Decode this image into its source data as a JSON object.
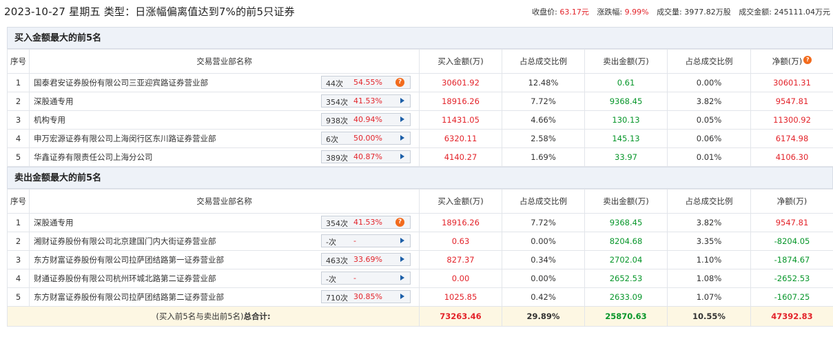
{
  "header": {
    "title": "2023-10-27 星期五 类型：日涨幅偏离值达到7%的前5只证券",
    "close_label": "收盘价:",
    "close_value": "63.17元",
    "change_label": "涨跌幅:",
    "change_value": "9.99%",
    "volume_label": "成交量:",
    "volume_value": "3977.82万股",
    "amount_label": "成交金额:",
    "amount_value": "245111.04万元"
  },
  "columns": {
    "seq": "序号",
    "name": "交易营业部名称",
    "buy": "买入金额(万)",
    "buy_ratio": "占总成交比例",
    "sell": "卖出金额(万)",
    "sell_ratio": "占总成交比例",
    "net": "净额(万)"
  },
  "buy_section": {
    "title": "买入金额最大的前5名",
    "rows": [
      {
        "seq": "1",
        "name": "国泰君安证券股份有限公司三亚迎宾路证券营业部",
        "count": "44次",
        "rate": "54.55%",
        "icon": "question-icon",
        "buy": "30601.92",
        "buy_ratio": "12.48%",
        "sell": "0.61",
        "sell_ratio": "0.00%",
        "net": "30601.31"
      },
      {
        "seq": "2",
        "name": "深股通专用",
        "count": "354次",
        "rate": "41.53%",
        "icon": "arrow-right-icon",
        "buy": "18916.26",
        "buy_ratio": "7.72%",
        "sell": "9368.45",
        "sell_ratio": "3.82%",
        "net": "9547.81"
      },
      {
        "seq": "3",
        "name": "机构专用",
        "count": "938次",
        "rate": "40.94%",
        "icon": "arrow-right-icon",
        "buy": "11431.05",
        "buy_ratio": "4.66%",
        "sell": "130.13",
        "sell_ratio": "0.05%",
        "net": "11300.92"
      },
      {
        "seq": "4",
        "name": "申万宏源证券有限公司上海闵行区东川路证券营业部",
        "count": "6次",
        "rate": "50.00%",
        "icon": "arrow-right-icon",
        "buy": "6320.11",
        "buy_ratio": "2.58%",
        "sell": "145.13",
        "sell_ratio": "0.06%",
        "net": "6174.98"
      },
      {
        "seq": "5",
        "name": "华鑫证券有限责任公司上海分公司",
        "count": "389次",
        "rate": "40.87%",
        "icon": "arrow-right-icon",
        "buy": "4140.27",
        "buy_ratio": "1.69%",
        "sell": "33.97",
        "sell_ratio": "0.01%",
        "net": "4106.30"
      }
    ]
  },
  "sell_section": {
    "title": "卖出金额最大的前5名",
    "rows": [
      {
        "seq": "1",
        "name": "深股通专用",
        "count": "354次",
        "rate": "41.53%",
        "icon": "question-icon",
        "buy": "18916.26",
        "buy_ratio": "7.72%",
        "sell": "9368.45",
        "sell_ratio": "3.82%",
        "net": "9547.81",
        "net_color": "red"
      },
      {
        "seq": "2",
        "name": "湘财证券股份有限公司北京建国门内大街证券营业部",
        "count": "-次",
        "rate": "-",
        "icon": "arrow-right-icon",
        "buy": "0.63",
        "buy_ratio": "0.00%",
        "sell": "8204.68",
        "sell_ratio": "3.35%",
        "net": "-8204.05",
        "net_color": "green"
      },
      {
        "seq": "3",
        "name": "东方财富证券股份有限公司拉萨团结路第一证券营业部",
        "count": "463次",
        "rate": "33.69%",
        "icon": "arrow-right-icon",
        "buy": "827.37",
        "buy_ratio": "0.34%",
        "sell": "2702.04",
        "sell_ratio": "1.10%",
        "net": "-1874.67",
        "net_color": "green"
      },
      {
        "seq": "4",
        "name": "财通证券股份有限公司杭州环城北路第二证券营业部",
        "count": "-次",
        "rate": "-",
        "icon": "arrow-right-icon",
        "buy": "0.00",
        "buy_ratio": "0.00%",
        "sell": "2652.53",
        "sell_ratio": "1.08%",
        "net": "-2652.53",
        "net_color": "green"
      },
      {
        "seq": "5",
        "name": "东方财富证券股份有限公司拉萨团结路第二证券营业部",
        "count": "710次",
        "rate": "30.85%",
        "icon": "arrow-right-icon",
        "buy": "1025.85",
        "buy_ratio": "0.42%",
        "sell": "2633.09",
        "sell_ratio": "1.07%",
        "net": "-1607.25",
        "net_color": "green"
      }
    ]
  },
  "total": {
    "label_prefix": "(买入前5名与卖出前5名)",
    "label_bold": "总合计:",
    "buy": "73263.46",
    "buy_ratio": "29.89%",
    "sell": "25870.63",
    "sell_ratio": "10.55%",
    "net": "47392.83"
  },
  "colors": {
    "red": "#e3232a",
    "green": "#07962a",
    "section_bg": "#eef2f8",
    "total_bg": "#fdf7e3"
  }
}
